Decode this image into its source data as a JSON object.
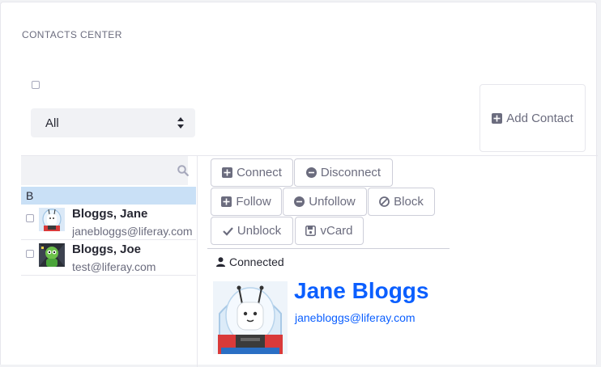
{
  "portlet": {
    "title": "CONTACTS CENTER"
  },
  "filter": {
    "selected": "All"
  },
  "toolbar": {
    "add_contact_label": "Add Contact"
  },
  "search": {
    "placeholder": ""
  },
  "contact_list": {
    "group_letter": "B",
    "contacts": [
      {
        "name": "Bloggs, Jane",
        "email": "janebloggs@liferay.com",
        "avatar": "astronaut-avatar"
      },
      {
        "name": "Bloggs, Joe",
        "email": "test@liferay.com",
        "avatar": "alien-avatar"
      }
    ]
  },
  "actions": {
    "connect": "Connect",
    "disconnect": "Disconnect",
    "follow": "Follow",
    "unfollow": "Unfollow",
    "block": "Block",
    "unblock": "Unblock",
    "vcard": "vCard"
  },
  "profile": {
    "status": "Connected",
    "name": "Jane Bloggs",
    "email": "janebloggs@liferay.com"
  },
  "colors": {
    "link": "#0b5fff",
    "selected_row": "#c9e0f6",
    "muted": "#6b6c7e"
  }
}
